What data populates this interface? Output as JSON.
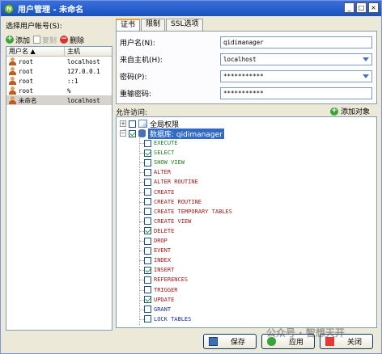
{
  "window": {
    "title": "用户管理 - 未命名",
    "app_icon_glyph": "N"
  },
  "left": {
    "select_label": "选择用户帐号(S):",
    "toolbar": {
      "add": "添加",
      "copy": "复制",
      "delete": "删除"
    },
    "columns": [
      "用户名",
      "主机"
    ],
    "users": [
      {
        "name": "root",
        "host": "localhost"
      },
      {
        "name": "root",
        "host": "127.0.0.1"
      },
      {
        "name": "root",
        "host": "::1"
      },
      {
        "name": "root",
        "host": "%"
      },
      {
        "name": "未命名",
        "host": "localhost"
      }
    ],
    "selected_index": 4
  },
  "tabs": [
    "证书",
    "限制",
    "SSL选项"
  ],
  "form": {
    "username_label": "用户名(N):",
    "username_value": "qidimanager",
    "host_label": "来自主机(H):",
    "host_value": "localhost",
    "password_label": "密码(P):",
    "password_value": "***********",
    "confirm_label": "重输密码:",
    "confirm_value": "***********"
  },
  "privileges": {
    "allow_label": "允许访问:",
    "add_object": "添加对象",
    "global_label": "全局权限",
    "db_label": "数据库:",
    "db_name": "qidimanager",
    "items": [
      {
        "name": "EXECUTE",
        "checked": false,
        "color": "#1a7f1a"
      },
      {
        "name": "SELECT",
        "checked": true,
        "color": "#1a7f1a"
      },
      {
        "name": "SHOW VIEW",
        "checked": false,
        "color": "#1a7f1a"
      },
      {
        "name": "ALTER",
        "checked": false,
        "color": "#a01818"
      },
      {
        "name": "ALTER ROUTINE",
        "checked": false,
        "color": "#a01818"
      },
      {
        "name": "CREATE",
        "checked": false,
        "color": "#a01818"
      },
      {
        "name": "CREATE ROUTINE",
        "checked": false,
        "color": "#a01818"
      },
      {
        "name": "CREATE TEMPORARY TABLES",
        "checked": false,
        "color": "#a01818"
      },
      {
        "name": "CREATE VIEW",
        "checked": false,
        "color": "#a01818"
      },
      {
        "name": "DELETE",
        "checked": true,
        "color": "#a01818"
      },
      {
        "name": "DROP",
        "checked": false,
        "color": "#a01818"
      },
      {
        "name": "EVENT",
        "checked": false,
        "color": "#a01818"
      },
      {
        "name": "INDEX",
        "checked": false,
        "color": "#a01818"
      },
      {
        "name": "INSERT",
        "checked": true,
        "color": "#a01818"
      },
      {
        "name": "REFERENCES",
        "checked": false,
        "color": "#a01818"
      },
      {
        "name": "TRIGGER",
        "checked": false,
        "color": "#a01818"
      },
      {
        "name": "UPDATE",
        "checked": true,
        "color": "#a01818"
      },
      {
        "name": "GRANT",
        "checked": false,
        "color": "#1a2f9a"
      },
      {
        "name": "LOCK TABLES",
        "checked": false,
        "color": "#1a2f9a"
      }
    ]
  },
  "buttons": {
    "save": "保存",
    "apply": "应用",
    "close": "关闭"
  },
  "watermark": "公众号 · 智想天开"
}
